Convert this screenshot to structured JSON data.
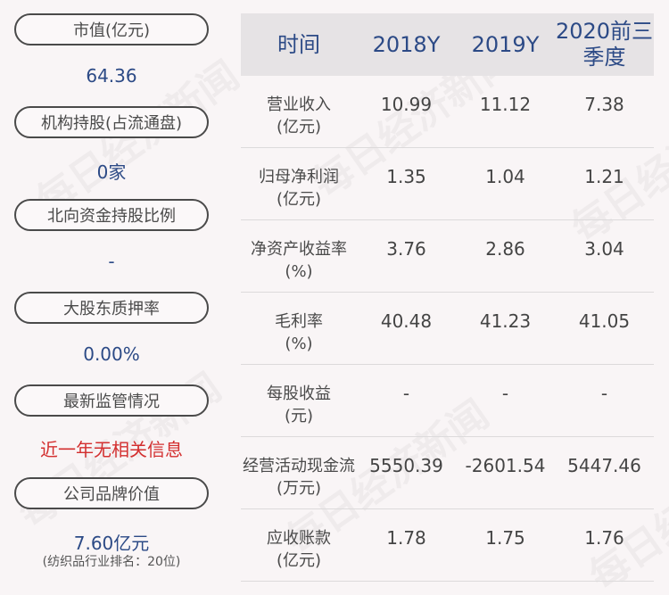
{
  "left": {
    "items": [
      {
        "label": "市值(亿元)",
        "value": "64.36"
      },
      {
        "label": "机构持股(占流通盘)",
        "value": "0家"
      },
      {
        "label": "北向资金持股比例",
        "value": "-"
      },
      {
        "label": "大股东质押率",
        "value": "0.00%"
      },
      {
        "label": "最新监管情况",
        "value": "近一年无相关信息"
      },
      {
        "label": "公司品牌价值",
        "value": "7.60亿元",
        "note": "(纺织品行业排名：20位)"
      }
    ]
  },
  "table": {
    "headers": [
      "时间",
      "2018Y",
      "2019Y",
      "2020前三季度"
    ],
    "rows": [
      {
        "label1": "营业收入",
        "label2": "(亿元)",
        "values": [
          "10.99",
          "11.12",
          "7.38"
        ]
      },
      {
        "label1": "归母净利润",
        "label2": "(亿元)",
        "values": [
          "1.35",
          "1.04",
          "1.21"
        ]
      },
      {
        "label1": "净资产收益率",
        "label2": "(%)",
        "values": [
          "3.76",
          "2.86",
          "3.04"
        ]
      },
      {
        "label1": "毛利率",
        "label2": "(%)",
        "values": [
          "40.48",
          "41.23",
          "41.05"
        ]
      },
      {
        "label1": "每股收益",
        "label2": "(元)",
        "values": [
          "-",
          "-",
          "-"
        ]
      },
      {
        "label1": "经营活动现金流",
        "label2": "(万元)",
        "values": [
          "5550.39",
          "-2601.54",
          "5447.46"
        ]
      },
      {
        "label1": "应收账款",
        "label2": "(亿元)",
        "values": [
          "1.78",
          "1.75",
          "1.76"
        ]
      }
    ]
  },
  "watermark": "每日经济新闻",
  "colors": {
    "accent": "#2c4a86",
    "alert": "#d32f2f",
    "header_bg": "#e6e3e5"
  }
}
